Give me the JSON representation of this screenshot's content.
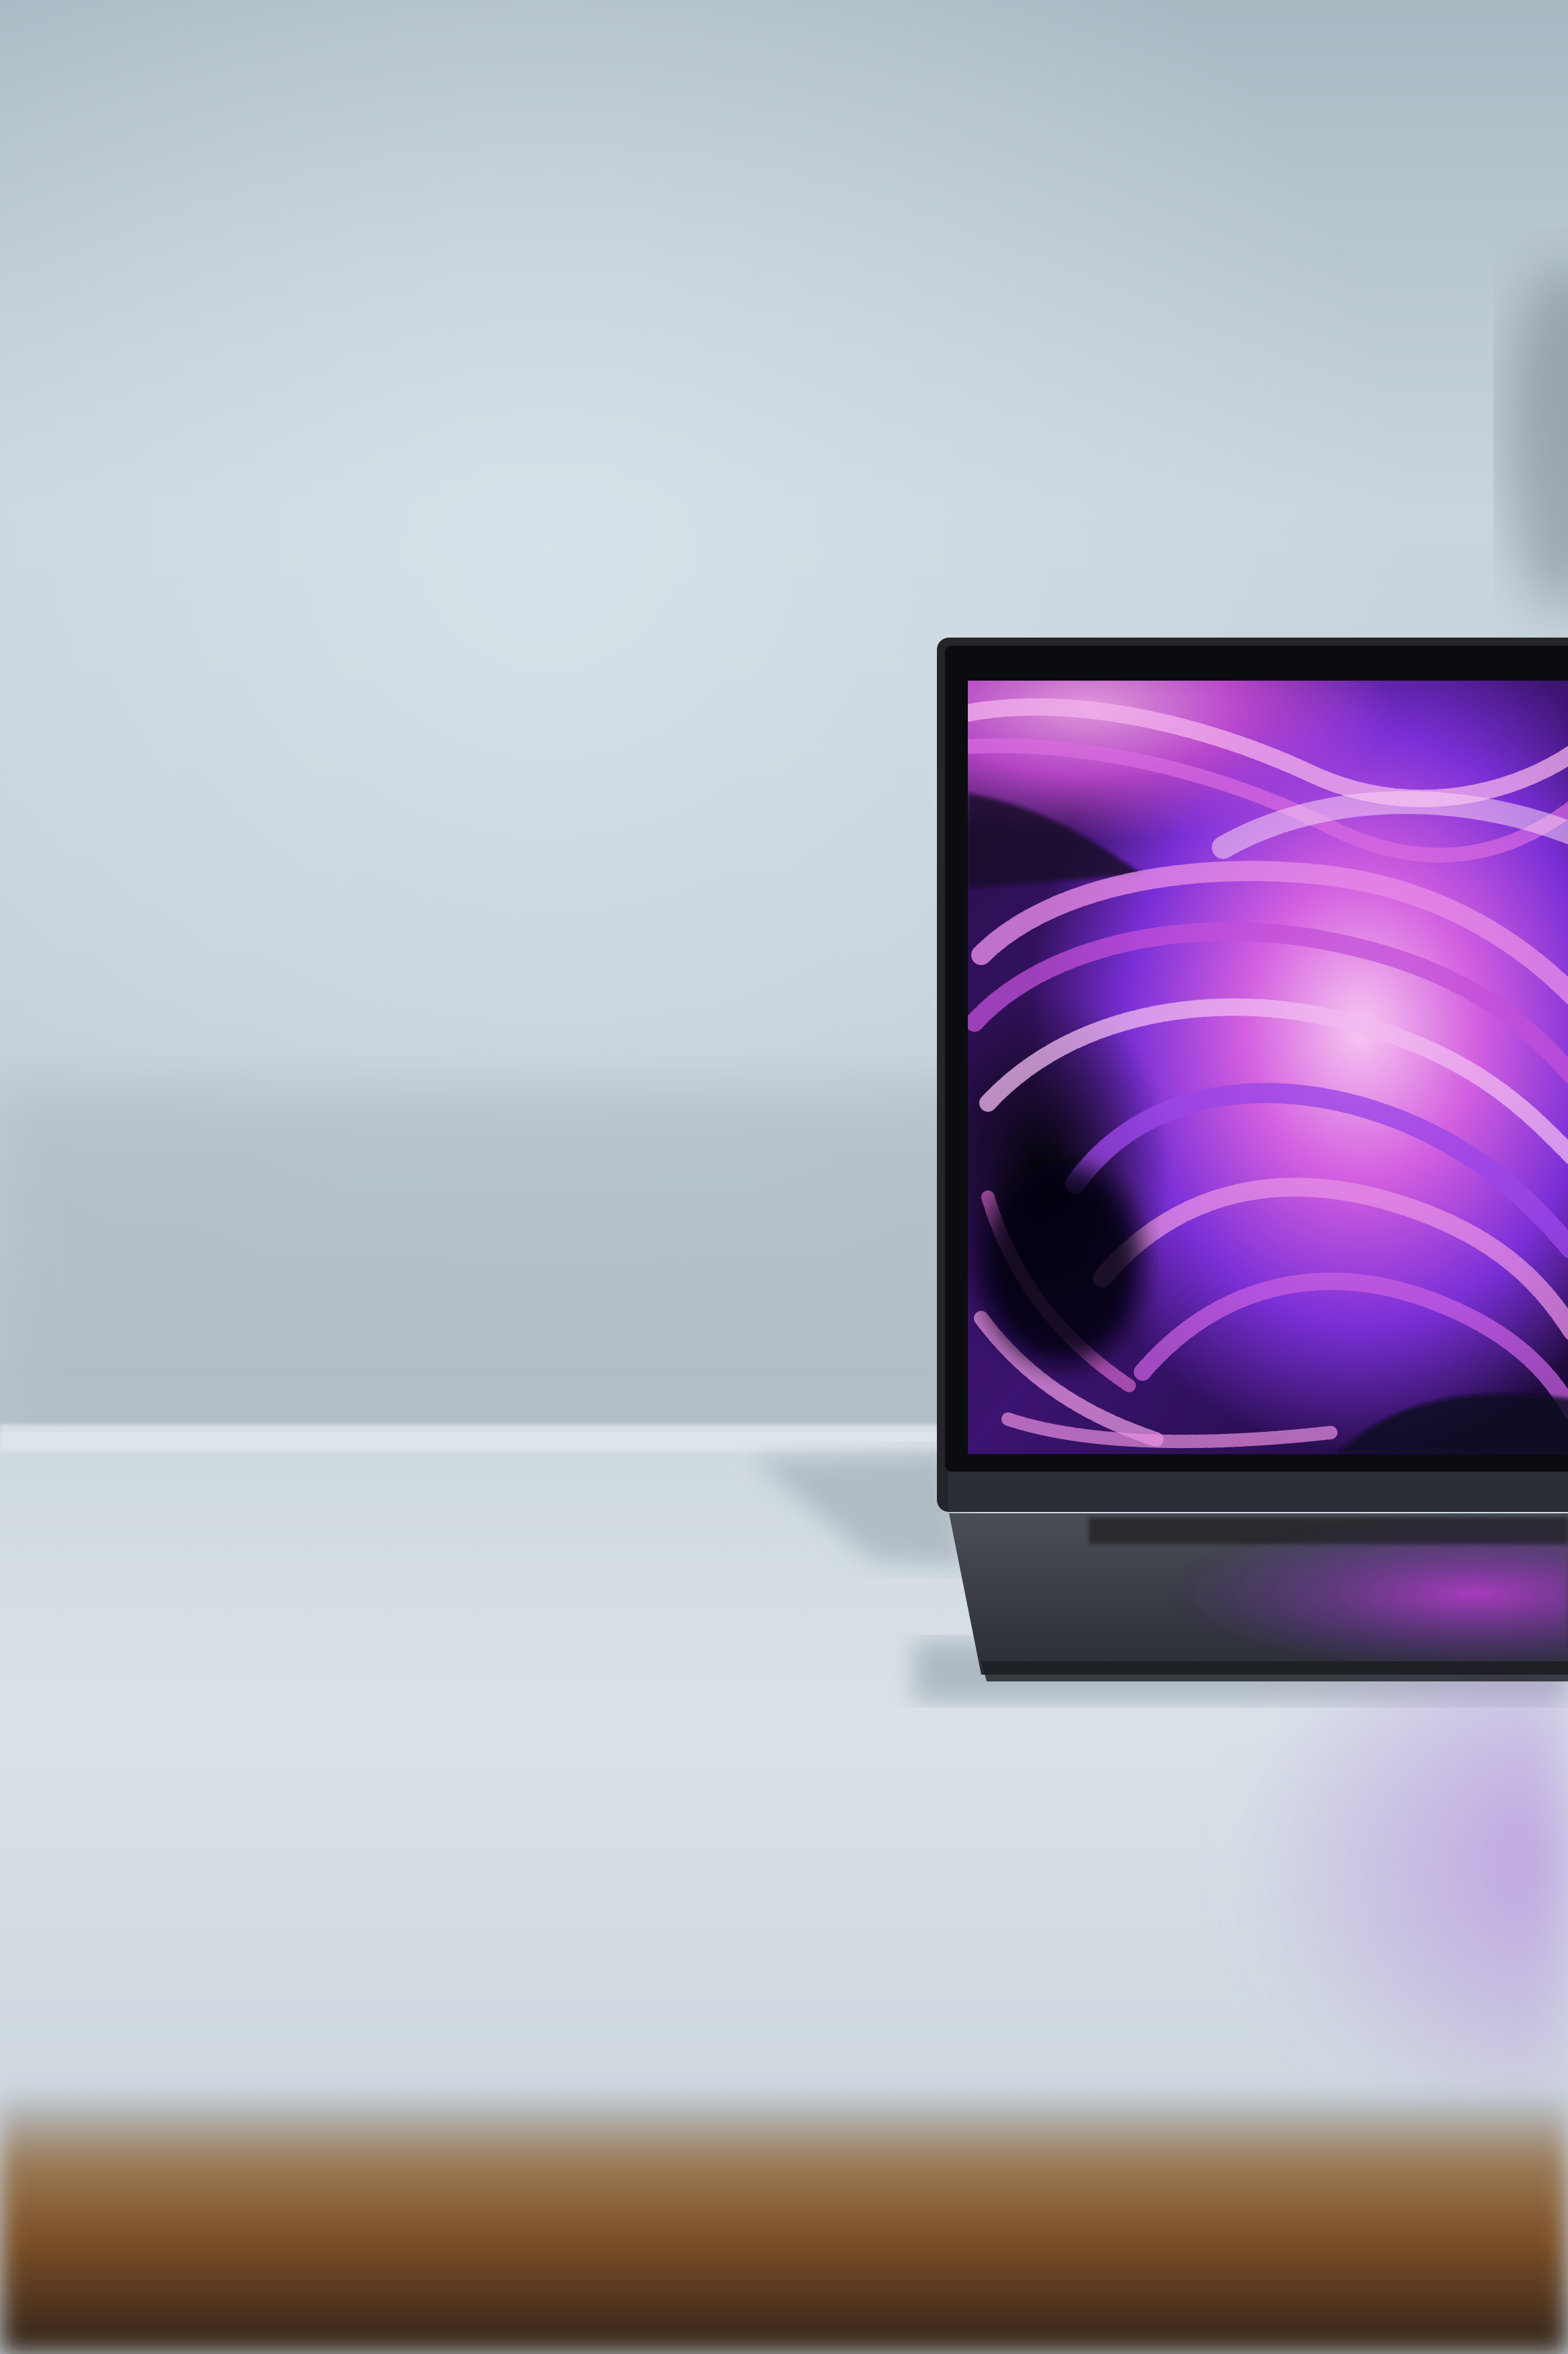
{
  "photo": {
    "subject": "laptop-on-white-desk",
    "colors": {
      "wall_top": "#aebdc6",
      "wall_mid": "#c7d4dc",
      "wall_low": "#bdc9d1",
      "desk_light": "#d6dfe6",
      "desk_shadow": "#9fadb8",
      "desk_edge_wood": "#8a5a2e",
      "desk_edge_dark": "#3b2a1c",
      "laptop_body": "#2a2d33",
      "laptop_bezel": "#0b0c10",
      "screen_dark": "#140a2e",
      "screen_purple": "#8a2be2",
      "screen_magenta": "#e040c8",
      "screen_pink": "#f3a6e6",
      "screen_glow": "#b06ee0"
    }
  }
}
